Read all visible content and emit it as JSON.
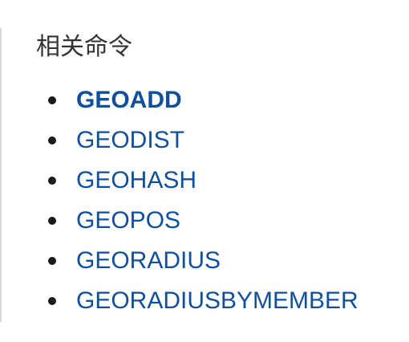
{
  "section": {
    "title": "相关命令"
  },
  "commands": [
    {
      "label": "GEOADD",
      "current": true
    },
    {
      "label": "GEODIST",
      "current": false
    },
    {
      "label": "GEOHASH",
      "current": false
    },
    {
      "label": "GEOPOS",
      "current": false
    },
    {
      "label": "GEORADIUS",
      "current": false
    },
    {
      "label": "GEORADIUSBYMEMBER",
      "current": false
    }
  ],
  "colors": {
    "link": "#0f4f9c",
    "heading": "#333333",
    "bullet": "#1a1a1a",
    "border": "#d9d9d9"
  }
}
